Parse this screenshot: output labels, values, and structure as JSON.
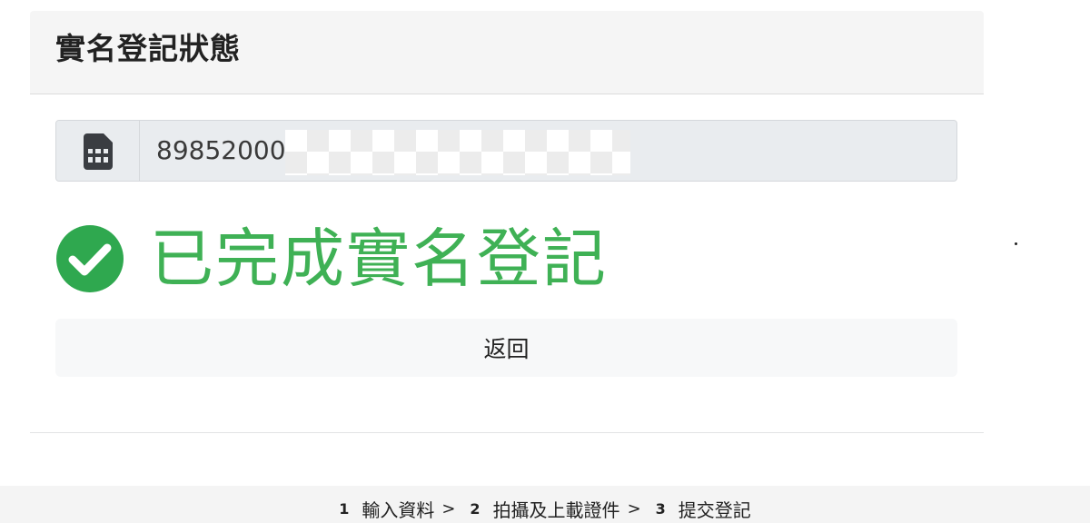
{
  "card": {
    "title": "實名登記狀態"
  },
  "sim": {
    "icon": "sim-card-icon",
    "value": "89852000",
    "masked": true
  },
  "status": {
    "icon": "check-circle-icon",
    "text": "已完成實名登記",
    "color": "#3fb155"
  },
  "actions": {
    "back_label": "返回"
  },
  "steps": [
    {
      "number": "1",
      "label": "輸入資料",
      "separator": ">"
    },
    {
      "number": "2",
      "label": "拍攝及上載證件",
      "separator": ">"
    },
    {
      "number": "3",
      "label": "提交登記",
      "separator": ""
    }
  ]
}
